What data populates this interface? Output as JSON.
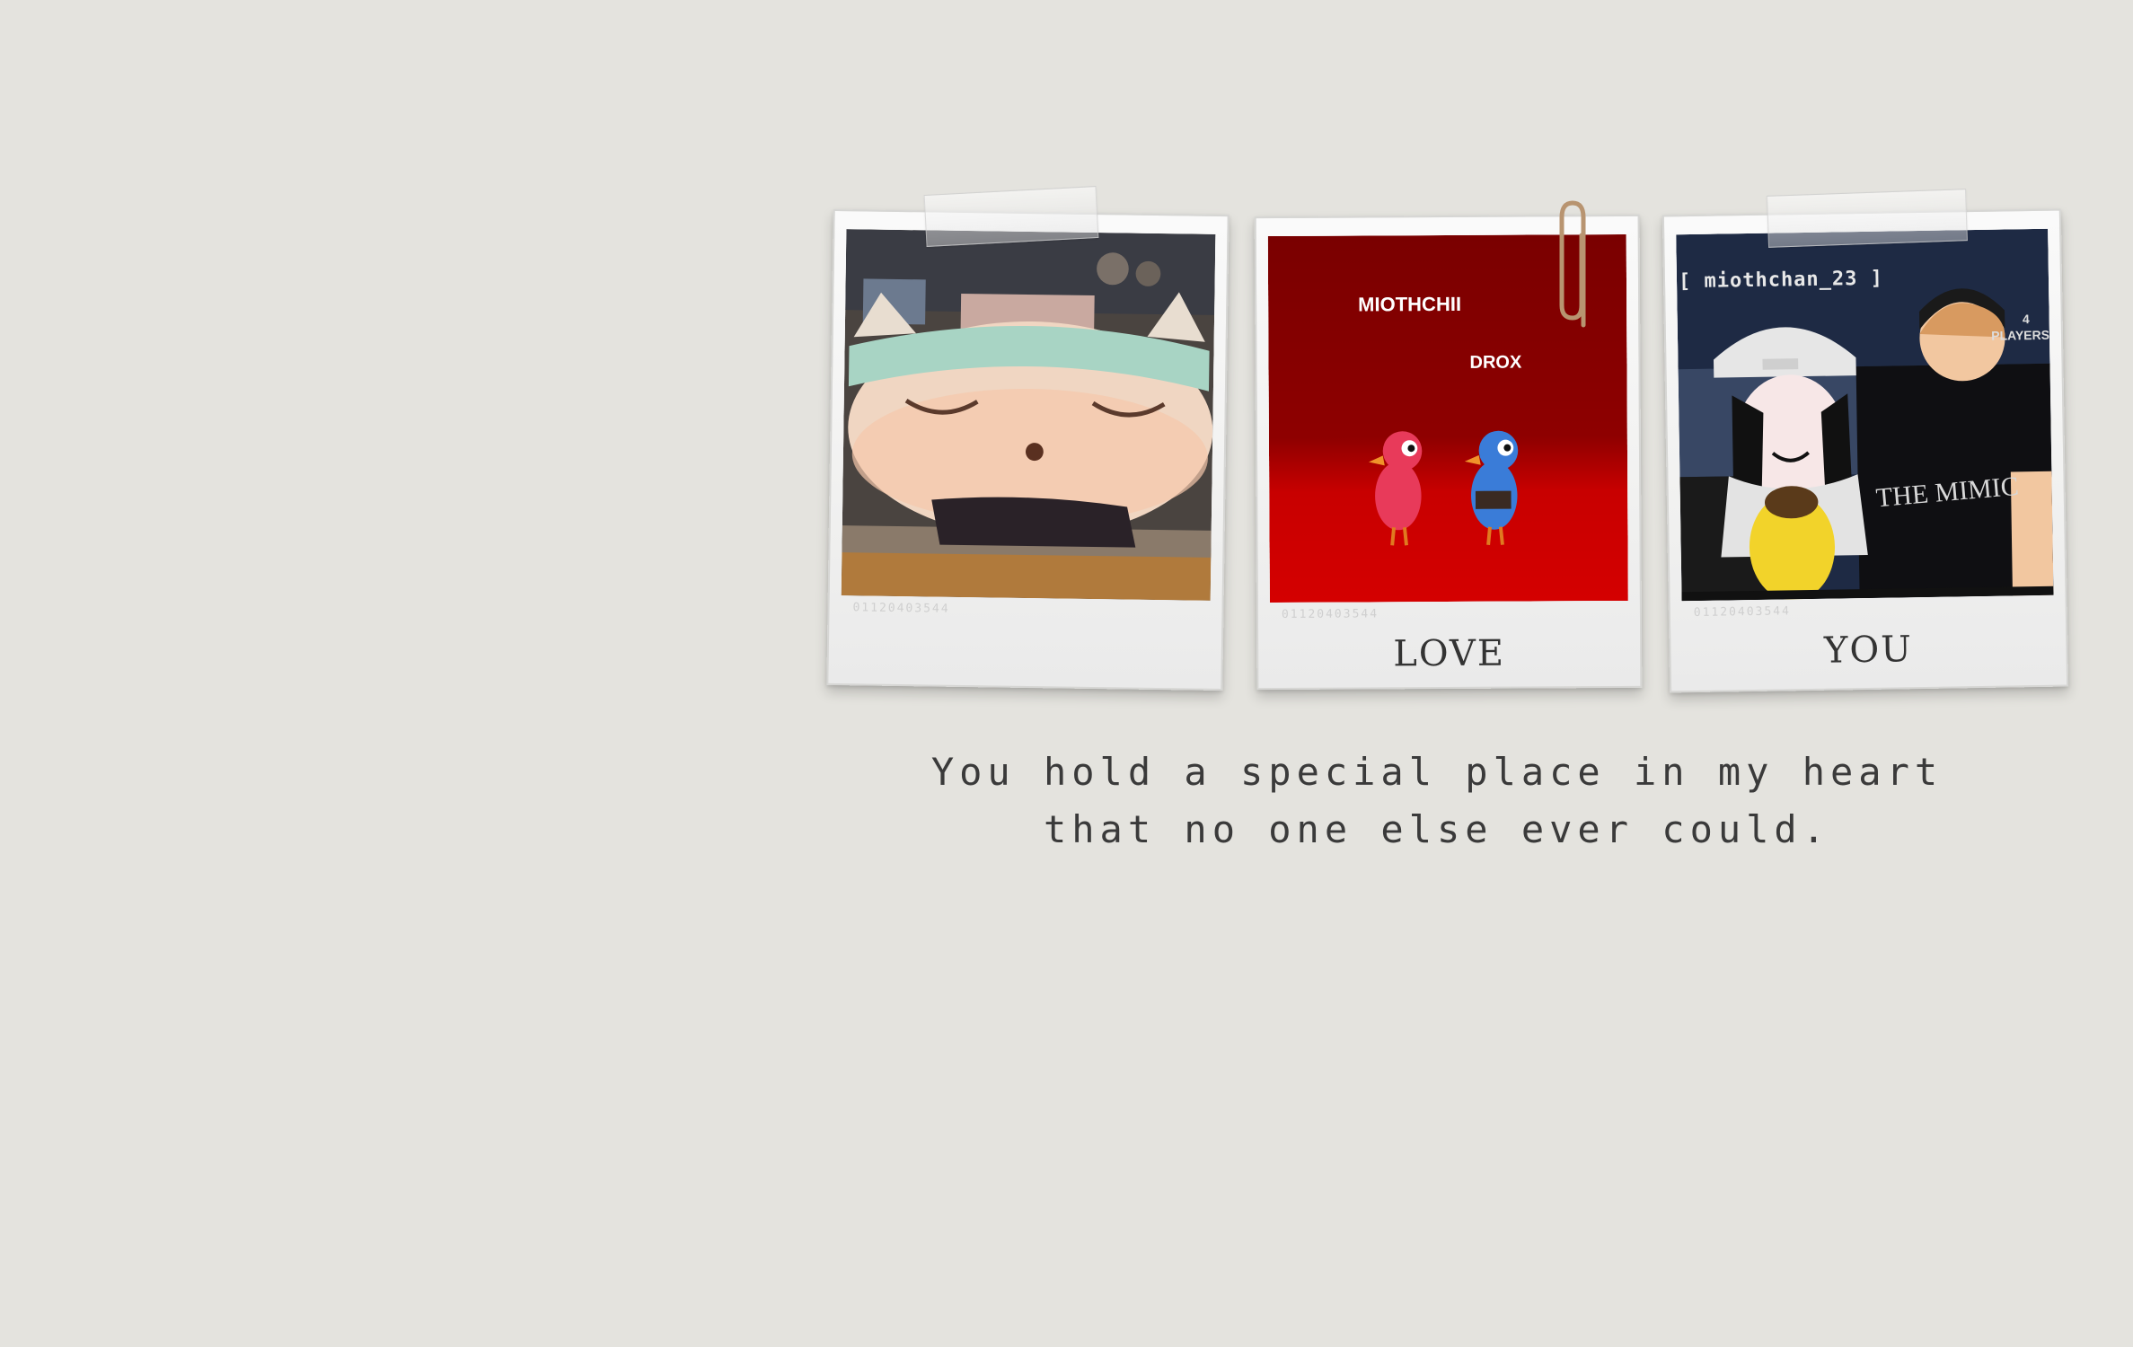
{
  "polaroids": [
    {
      "caption": "",
      "serial": "01120403544",
      "photo": {
        "description_icon": "cat-eye-mask-photo"
      }
    },
    {
      "caption": "LOVE",
      "serial": "01120403544",
      "photo": {
        "player_names": [
          "MIOTHCHII",
          "DROX"
        ]
      }
    },
    {
      "caption": "YOU",
      "serial": "01120403544",
      "photo": {
        "username_tag": "[ miothchan_23 ]",
        "players_count": "4",
        "players_label": "PLAYERS",
        "shirt_text": "THE MIMIC"
      }
    }
  ],
  "message": {
    "line1": "You hold a special place in my heart",
    "line2": "that no one else ever could."
  },
  "colors": {
    "background": "#e4e3de",
    "red_photo": "#b00000",
    "text": "#3a3a3a"
  }
}
